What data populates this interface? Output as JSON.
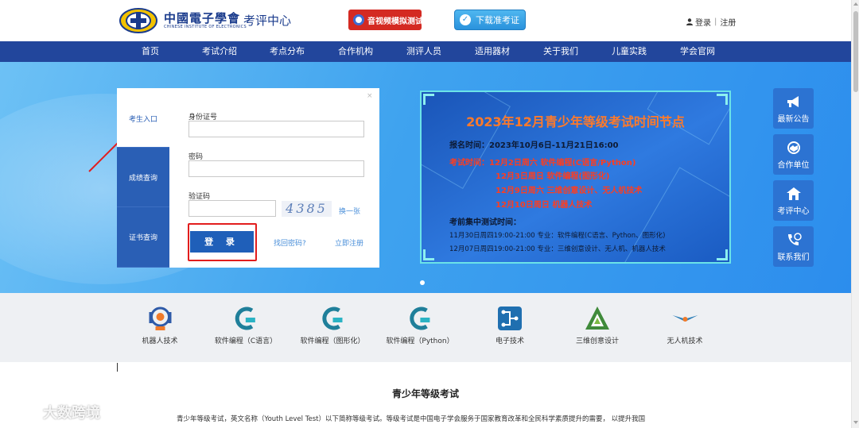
{
  "header": {
    "logo_cn": "中國電子學會",
    "logo_en": "CHINESE INSTITUTE OF ELECTRONICS",
    "logo_center": "考评中心",
    "video_test_label": "音视频模拟测试",
    "download_label": "下载准考证",
    "login_label": "登录",
    "register_label": "注册"
  },
  "nav": {
    "items": [
      "首页",
      "考试介绍",
      "考点分布",
      "合作机构",
      "测评人员",
      "适用器材",
      "关于我们",
      "儿童实践",
      "学会官网"
    ]
  },
  "login": {
    "tabs": [
      "考生入口",
      "成绩查询",
      "证书查询"
    ],
    "close": "×",
    "id_label": "身份证号",
    "password_label": "密码",
    "captcha_label": "验证码",
    "captcha_text": "4385",
    "refresh_label": "换一张",
    "submit_label": "登 录",
    "forgot_label": "找回密码?",
    "register_label": "立即注册"
  },
  "notice": {
    "title": "2023年12月青少年等级考试时间节点",
    "reg_time": "报名时间：2023年10月6日-11月21日16:00",
    "exam_time_1": "考试时间：12月2日周六  软件编程(C语言/Python)",
    "exam_time_2": "12月3日周日  软件编程(图形化)",
    "exam_time_3": "12月9日周六  三维创意设计、无人机技术",
    "exam_time_4": "12月10日周日  机器人技术",
    "pretest_title": "考前集中测试时间：",
    "pretest_1": "11月30日周四19:00-21:00  专业：软件编程(C语言、Python、图形化)",
    "pretest_2": "12月07日周四19:00-21:00  专业：三维创意设计、无人机、机器人技术"
  },
  "side": {
    "items": [
      "最新公告",
      "合作单位",
      "考评中心",
      "联系我们"
    ]
  },
  "categories": {
    "items": [
      "机器人技术",
      "软件编程（C语言）",
      "软件编程（图形化）",
      "软件编程（Python）",
      "电子技术",
      "三维创意设计",
      "无人机技术"
    ]
  },
  "content": {
    "title": "青少年等级考试",
    "text": "青少年等级考试，英文名称（Youth Level Test）以下简称等级考试。等级考试是中国电子学会服务于国家教育改革和全民科学素质提升的需要， 以提升我国"
  },
  "watermark": "大数跨境",
  "colors": {
    "nav_bg": "#22469c",
    "accent_blue": "#2c73d2",
    "title_orange": "#ff7a2a",
    "highlight_red": "#e21d1d"
  }
}
